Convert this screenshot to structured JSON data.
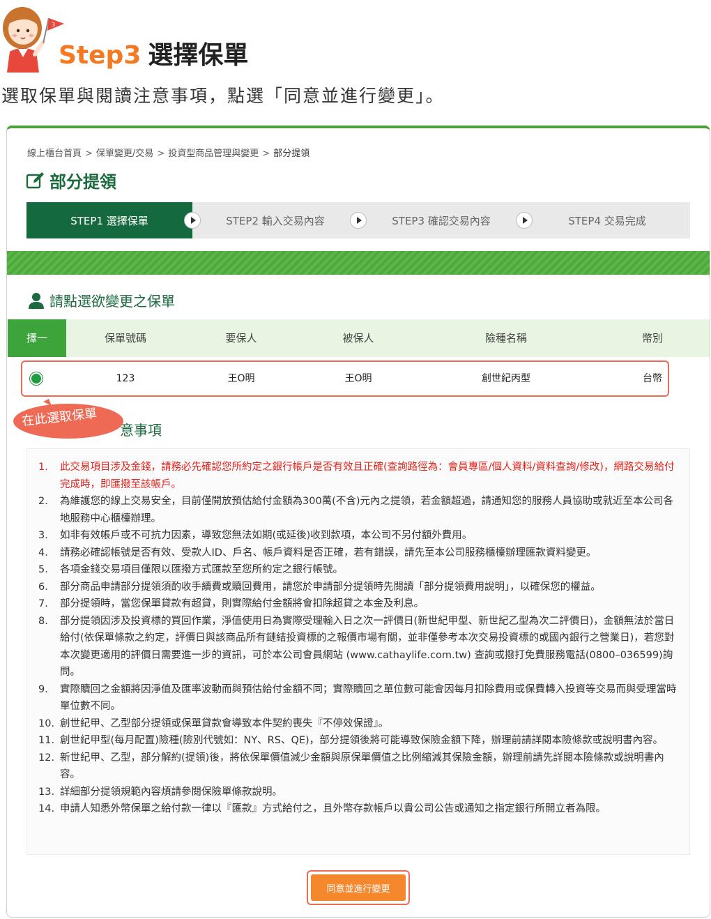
{
  "header": {
    "step_number": "Step3",
    "step_name": "選擇保單",
    "intro": "選取保單與閱讀注意事項，點選「同意並進行變更」。"
  },
  "breadcrumb": [
    "線上櫃台首頁",
    "保單變更/交易",
    "投資型商品管理與變更",
    "部分提領"
  ],
  "breadcrumb_sep": ">",
  "page_title": "部分提領",
  "steps": [
    {
      "label": "STEP1 選擇保單",
      "active": true
    },
    {
      "label": "STEP2 輸入交易內容",
      "active": false
    },
    {
      "label": "STEP3 確認交易內容",
      "active": false
    },
    {
      "label": "STEP4 交易完成",
      "active": false
    }
  ],
  "select_section_title": "請點選欲變更之保單",
  "table": {
    "headers": [
      "擇一",
      "保單號碼",
      "要保人",
      "被保人",
      "險種名稱",
      "幣別"
    ],
    "row": {
      "policy_no": "123",
      "applicant": "王O明",
      "insured": "王O明",
      "product": "創世紀丙型",
      "currency": "台幣",
      "selected": true
    }
  },
  "callout": "在此選取保單",
  "notes_title": "注意事項",
  "notes_title_visible": "意事項",
  "notes": [
    {
      "n": "1.",
      "text": "此交易項目涉及金錢，請務必先確認您所約定之銀行帳戶是否有效且正確(查詢路徑為：會員專區/個人資料/資料查詢/修改)，網路交易給付完成時，即匯撥至該帳戶。",
      "red": true
    },
    {
      "n": "2.",
      "text": "為維護您的線上交易安全，目前僅開放預估給付金額為300萬(不含)元內之提領，若金額超過，請通知您的服務人員協助或就近至本公司各地服務中心櫃檯辦理。"
    },
    {
      "n": "3.",
      "text": "如非有效帳戶或不可抗力因素，導致您無法如期(或延後)收到款項，本公司不另付額外費用。"
    },
    {
      "n": "4.",
      "text": "請務必確認帳號是否有效、受款人ID、戶名、帳戶資料是否正確，若有錯誤，請先至本公司服務櫃檯辦理匯款資料變更。"
    },
    {
      "n": "5.",
      "text": "各項金錢交易項目僅限以匯撥方式匯款至您所約定之銀行帳號。"
    },
    {
      "n": "6.",
      "text": "部分商品申請部分提領須酌收手續費或贖回費用，請您於申請部分提領時先閱讀「部分提領費用說明」，以確保您的權益。"
    },
    {
      "n": "7.",
      "text": "部分提領時，當您保單貸款有超貸，則實際給付金額將會扣除超貸之本金及利息。"
    },
    {
      "n": "8.",
      "text": "部分提領因涉及投資標的買回作業，淨值使用日為實際受理輸入日之次一評價日(新世紀甲型、新世紀乙型為次二評價日)，金額無法於當日給付(依保單條款之約定，評價日與該商品所有鏈結投資標的之報價市場有關，並非僅參考本次交易投資標的或國內銀行之營業日)，若您對本次變更適用的評價日需要進一步的資訊，可於本公司會員網站 (www.cathaylife.com.tw) 查詢或撥打免費服務電話(0800–036599)詢問。"
    },
    {
      "n": "9.",
      "text": "實際贖回之金額將因淨值及匯率波動而與預估給付金額不同；實際贖回之單位數可能會因每月扣除費用或保費轉入投資等交易而與受理當時單位數不同。"
    },
    {
      "n": "10.",
      "text": "創世紀甲、乙型部分提領或保單貸款會導致本件契約喪失『不停效保證』。"
    },
    {
      "n": "11.",
      "text": "創世紀甲型(每月配置)險種(險別代號如：NY、RS、QE)，部分提領後將可能導致保險金額下降，辦理前請詳閱本險條款或說明書內容。"
    },
    {
      "n": "12.",
      "text": "新世紀甲、乙型，部分解約(提領)後，將依保單價值減少金額與原保單價值之比例縮減其保險金額，辦理前請先詳閱本險條款或說明書內容。"
    },
    {
      "n": "13.",
      "text": "詳細部分提領規範內容煩請參閱保險單條款說明。"
    },
    {
      "n": "14.",
      "text": "申請人知悉外幣保單之給付款一律以『匯款』方式給付之，且外幣存款帳戶以貴公司公告或通知之指定銀行所開立者為限。"
    }
  ],
  "agree_button": "同意並進行變更",
  "colors": {
    "brand_green": "#1c6b3f",
    "accent_orange": "#f47920",
    "highlight_red": "#ef6a55",
    "stripe_green": "#4fa83c"
  }
}
